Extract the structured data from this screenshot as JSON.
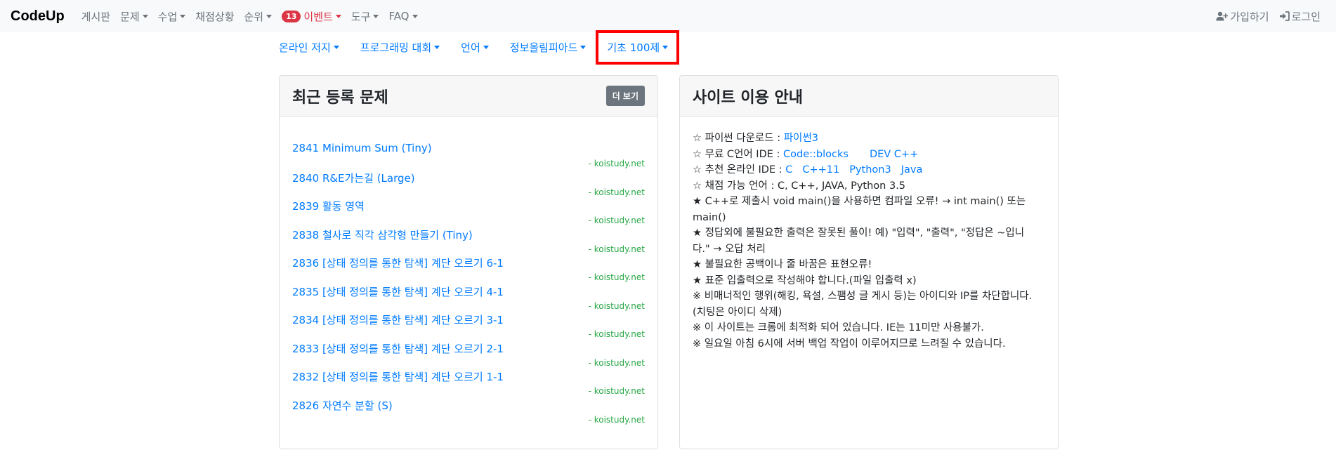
{
  "navbar": {
    "brand": "CodeUp",
    "items": [
      {
        "label": "게시판"
      },
      {
        "label": "문제"
      },
      {
        "label": "수업"
      },
      {
        "label": "채점상황"
      },
      {
        "label": "순위"
      },
      {
        "label": "이벤트",
        "badge": "13"
      },
      {
        "label": "도구"
      },
      {
        "label": "FAQ"
      }
    ],
    "signup": "가입하기",
    "login": "로그인"
  },
  "subnav": {
    "items": [
      {
        "label": "온라인 저지"
      },
      {
        "label": "프로그래밍 대회"
      },
      {
        "label": "언어"
      },
      {
        "label": "정보올림피아드"
      },
      {
        "label": "기초 100제"
      }
    ]
  },
  "recent": {
    "title": "최근 등록 문제",
    "more": "더 보기",
    "problems": [
      {
        "title": "2841 Minimum Sum (Tiny)",
        "source": "- koistudy.net"
      },
      {
        "title": "2840 R&E가는길 (Large)",
        "source": "- koistudy.net"
      },
      {
        "title": "2839 활동 영역",
        "source": "- koistudy.net"
      },
      {
        "title": "2838 철사로 직각 삼각형 만들기 (Tiny)",
        "source": "- koistudy.net"
      },
      {
        "title": "2836 [상태 정의를 통한 탐색] 계단 오르기 6-1",
        "source": "- koistudy.net"
      },
      {
        "title": "2835 [상태 정의를 통한 탐색] 계단 오르기 4-1",
        "source": "- koistudy.net"
      },
      {
        "title": "2834 [상태 정의를 통한 탐색] 계단 오르기 3-1",
        "source": "- koistudy.net"
      },
      {
        "title": "2833 [상태 정의를 통한 탐색] 계단 오르기 2-1",
        "source": "- koistudy.net"
      },
      {
        "title": "2832 [상태 정의를 통한 탐색] 계단 오르기 1-1",
        "source": "- koistudy.net"
      },
      {
        "title": "2826 자연수 분할 (S)",
        "source": "- koistudy.net"
      }
    ]
  },
  "guide": {
    "title": "사이트 이용 안내",
    "python_prefix": "☆ 파이썬 다운로드 : ",
    "python_link": "파이썬3",
    "c_ide_prefix": "☆ 무료 C언어 IDE : ",
    "c_ide_links": [
      "Code::blocks",
      "DEV C++"
    ],
    "online_ide_prefix": "☆ 추천 온라인 IDE : ",
    "online_ide_links": [
      "C",
      "C++11",
      "Python3",
      "Java"
    ],
    "lines": [
      "☆ 채점 가능 언어 : C, C++, JAVA, Python 3.5",
      "★ C++로 제출시 void main()을 사용하면 컴파일 오류! → int main() 또는",
      "main()",
      "★ 정답외에 불필요한 출력은 잘못된 풀이!  예) \"입력\", \"출력\", \"정답은 ~입니",
      "다.\" → 오답 처리",
      "★ 불필요한 공백이나 줄 바꿈은 표현오류!",
      "★ 표준 입출력으로 작성해야 합니다.(파일 입출력 x)",
      "※ 비매너적인 행위(해킹, 욕설, 스팸성 글 게시 등)는 아이디와 IP를 차단합니다.",
      "(치팅은 아이디 삭제)",
      "※ 이 사이트는 크롬에 최적화 되어 있습니다. IE는 11미만 사용불가.",
      "※ 일요일 아침 6시에 서버 백업 작업이 이루어지므로 느려질 수 있습니다."
    ]
  },
  "colors": {
    "link": "#007bff",
    "source": "#28a745",
    "badge": "#dc3545",
    "highlight_box": "#ff0000",
    "button": "#6c757d"
  }
}
